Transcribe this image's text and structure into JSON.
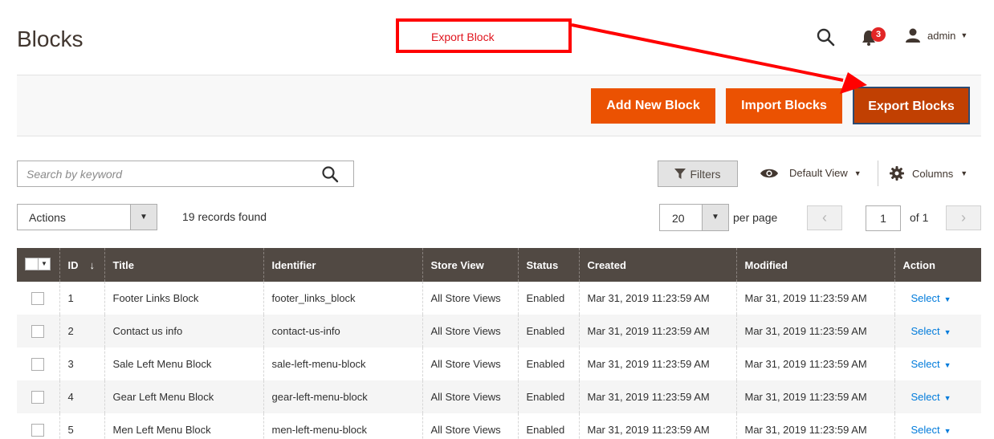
{
  "header": {
    "page_title": "Blocks",
    "notification_count": "3",
    "user_name": "admin"
  },
  "annotation": {
    "callout_text": "Export Block",
    "color": "#ff0000"
  },
  "toolbar": {
    "add_label": "Add New Block",
    "import_label": "Import Blocks",
    "export_label": "Export Blocks",
    "accent": "#eb5202"
  },
  "search": {
    "placeholder": "Search by keyword"
  },
  "controls": {
    "filters_label": "Filters",
    "view_label": "Default View",
    "columns_label": "Columns",
    "actions_label": "Actions",
    "records_found": "19 records found",
    "per_page_value": "20",
    "per_page_label": "per page",
    "current_page": "1",
    "page_of": "of 1"
  },
  "table": {
    "columns": [
      "ID",
      "Title",
      "Identifier",
      "Store View",
      "Status",
      "Created",
      "Modified",
      "Action"
    ],
    "rows": [
      [
        "1",
        "Footer Links Block",
        "footer_links_block",
        "All Store Views",
        "Enabled",
        "Mar 31, 2019 11:23:59 AM",
        "Mar 31, 2019 11:23:59 AM",
        "Select"
      ],
      [
        "2",
        "Contact us info",
        "contact-us-info",
        "All Store Views",
        "Enabled",
        "Mar 31, 2019 11:23:59 AM",
        "Mar 31, 2019 11:23:59 AM",
        "Select"
      ],
      [
        "3",
        "Sale Left Menu Block",
        "sale-left-menu-block",
        "All Store Views",
        "Enabled",
        "Mar 31, 2019 11:23:59 AM",
        "Mar 31, 2019 11:23:59 AM",
        "Select"
      ],
      [
        "4",
        "Gear Left Menu Block",
        "gear-left-menu-block",
        "All Store Views",
        "Enabled",
        "Mar 31, 2019 11:23:59 AM",
        "Mar 31, 2019 11:23:59 AM",
        "Select"
      ],
      [
        "5",
        "Men Left Menu Block",
        "men-left-menu-block",
        "All Store Views",
        "Enabled",
        "Mar 31, 2019 11:23:59 AM",
        "Mar 31, 2019 11:23:59 AM",
        "Select"
      ]
    ]
  }
}
